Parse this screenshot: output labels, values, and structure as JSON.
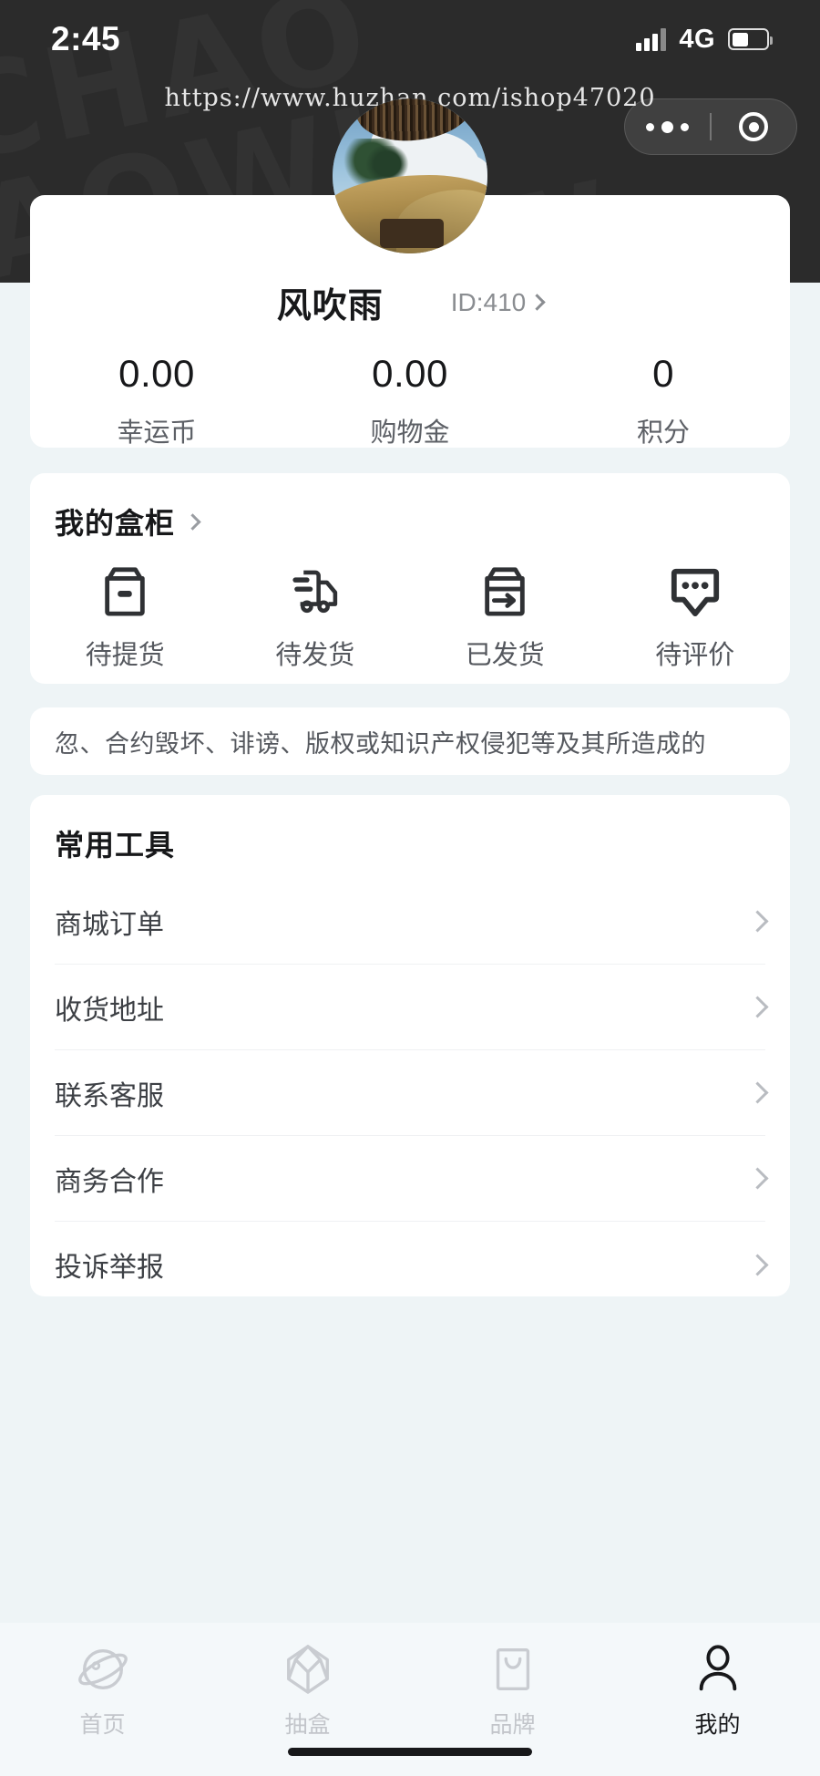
{
  "status_bar": {
    "time": "2:45",
    "network": "4G",
    "signal_icon": "signal-bars-icon",
    "battery_icon": "battery-icon"
  },
  "browser": {
    "url": "https://www.huzhan.com/ishop47020",
    "capsule": {
      "menu_icon": "more-dots-icon",
      "close_icon": "target-circle-icon"
    }
  },
  "profile": {
    "avatar_alt": "beach-palm-avatar",
    "name": "风吹雨",
    "id_label": "ID:410",
    "id_chevron_icon": "chevron-right-icon",
    "stats": [
      {
        "value": "0.00",
        "label": "幸运币"
      },
      {
        "value": "0.00",
        "label": "购物金"
      },
      {
        "value": "0",
        "label": "积分"
      }
    ]
  },
  "cabinet": {
    "title": "我的盒柜",
    "title_chevron_icon": "chevron-right-icon",
    "items": [
      {
        "label": "待提货",
        "icon": "box-icon"
      },
      {
        "label": "待发货",
        "icon": "truck-icon"
      },
      {
        "label": "已发货",
        "icon": "box-arrow-out-icon"
      },
      {
        "label": "待评价",
        "icon": "comment-bubble-icon"
      }
    ]
  },
  "notice": {
    "text": "忽、合约毁坏、诽谤、版权或知识产权侵犯等及其所造成的"
  },
  "tools": {
    "title": "常用工具",
    "items": [
      {
        "label": "商城订单",
        "chevron_icon": "chevron-right-icon"
      },
      {
        "label": "收货地址",
        "chevron_icon": "chevron-right-icon"
      },
      {
        "label": "联系客服",
        "chevron_icon": "chevron-right-icon"
      },
      {
        "label": "商务合作",
        "chevron_icon": "chevron-right-icon"
      },
      {
        "label": "投诉举报",
        "chevron_icon": "chevron-right-icon"
      }
    ]
  },
  "tabbar": {
    "items": [
      {
        "label": "首页",
        "icon": "planet-icon",
        "active": false
      },
      {
        "label": "抽盒",
        "icon": "cube-box-icon",
        "active": false
      },
      {
        "label": "品牌",
        "icon": "shopping-bag-icon",
        "active": false
      },
      {
        "label": "我的",
        "icon": "person-icon",
        "active": true
      }
    ]
  },
  "colors": {
    "header_bg": "#2b2b2b",
    "page_bg": "#eef4f6",
    "card_bg": "#ffffff",
    "text_primary": "#17181a",
    "text_secondary": "#55585e",
    "text_muted": "#c2c5ca"
  },
  "watermark": {
    "line1": "CHAO",
    "line2": "HAOWI",
    "line3": "CHAOW"
  }
}
